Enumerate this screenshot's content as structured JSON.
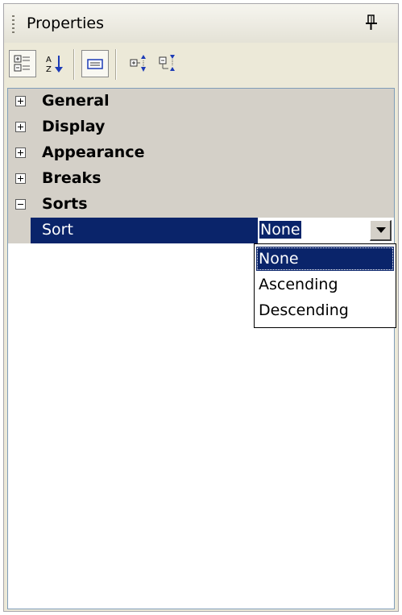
{
  "panel": {
    "title": "Properties",
    "pin_icon": "pin-icon"
  },
  "toolbar": {
    "buttons": [
      {
        "icon": "categorized-icon",
        "active": true
      },
      {
        "icon": "sort-alphabetical-icon",
        "active": false
      },
      {
        "icon": "property-pages-icon",
        "active": true
      },
      {
        "icon": "expand-all-icon",
        "active": false
      },
      {
        "icon": "collapse-all-icon",
        "active": false
      }
    ]
  },
  "grid": {
    "categories": [
      {
        "label": "General",
        "expanded": false
      },
      {
        "label": "Display",
        "expanded": false
      },
      {
        "label": "Appearance",
        "expanded": false
      },
      {
        "label": "Breaks",
        "expanded": false
      },
      {
        "label": "Sorts",
        "expanded": true
      }
    ],
    "property": {
      "name": "Sort",
      "value": "None"
    }
  },
  "dropdown": {
    "options": [
      "None",
      "Ascending",
      "Descending"
    ],
    "selected": "None"
  },
  "colors": {
    "selection": "#0a246a",
    "category_bg": "#d4d0c8",
    "panel_bg": "#ece9d8"
  }
}
